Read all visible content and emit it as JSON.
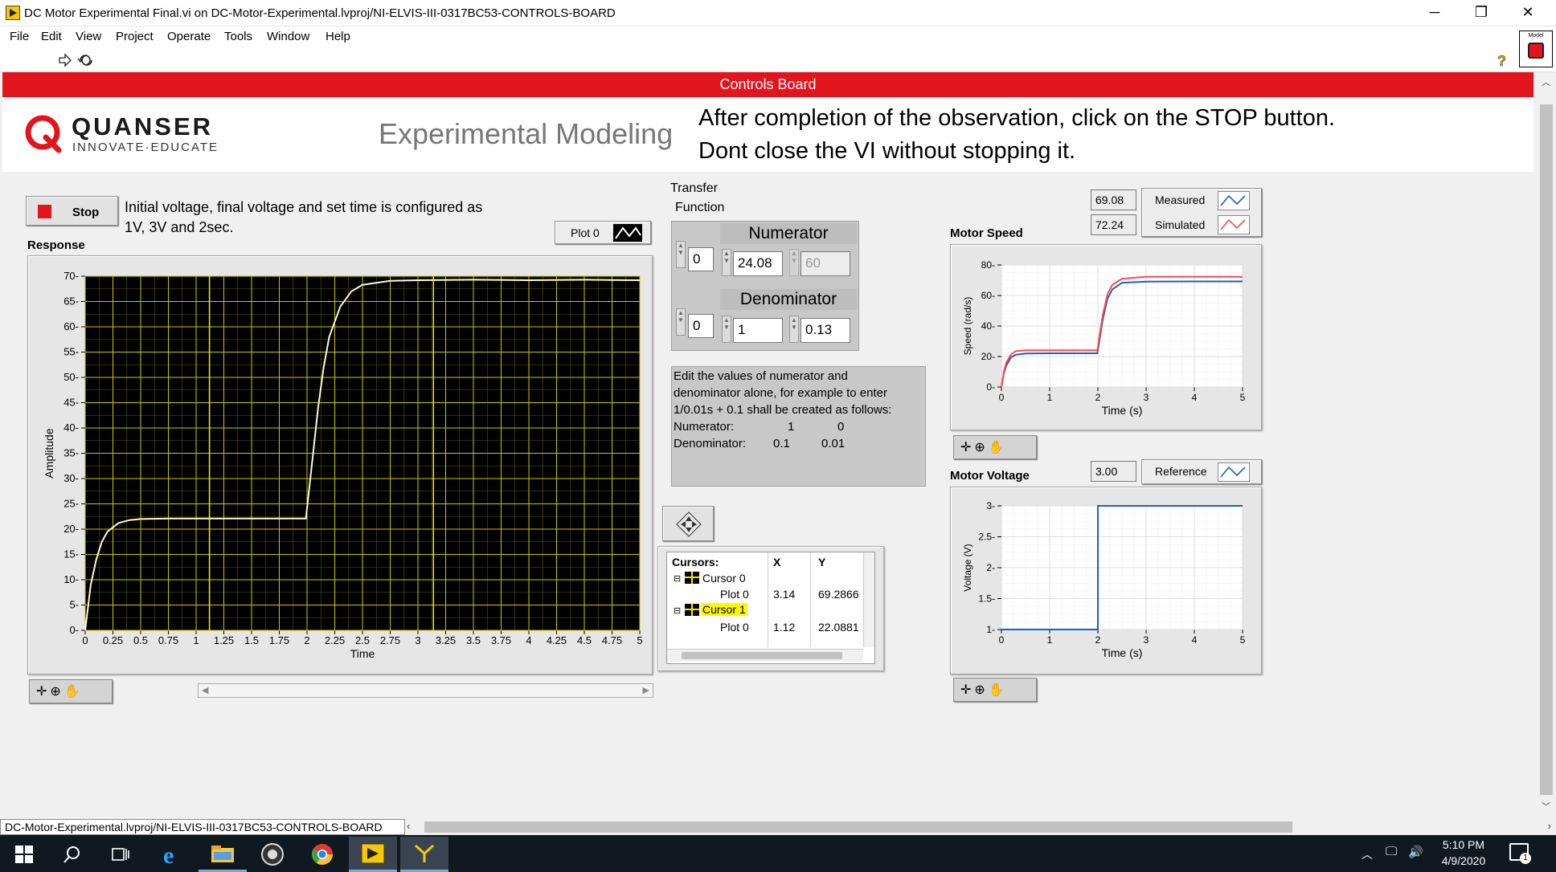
{
  "window": {
    "title": "DC Motor Experimental Final.vi on DC-Motor-Experimental.lvproj/NI-ELVIS-III-0317BC53-CONTROLS-BOARD",
    "minimize": "─",
    "maximize": "❐",
    "close": "✕"
  },
  "menu": [
    "File",
    "Edit",
    "View",
    "Project",
    "Operate",
    "Tools",
    "Window",
    "Help"
  ],
  "vi_icon_label": "Model",
  "banner": "Controls Board",
  "header": {
    "logo_name": "QUANSER",
    "logo_tagline": "INNOVATE·EDUCATE",
    "subtitle": "Experimental Modeling",
    "instruction_line1": "After completion of the observation, click on the STOP button.",
    "instruction_line2": "Dont close the VI without stopping it."
  },
  "controls": {
    "stop_label": "Stop",
    "info_text_line1": "Initial voltage, final voltage and set time is configured as",
    "info_text_line2": "1V, 3V and 2sec.",
    "plot_legend": "Plot 0"
  },
  "transfer_function": {
    "title_line1": "Transfer",
    "title_line2": "Function",
    "numerator_label": "Numerator",
    "numerator_index": "0",
    "numerator_values": [
      "24.08",
      "60"
    ],
    "denominator_label": "Denominator",
    "denominator_index": "0",
    "denominator_values": [
      "1",
      "0.13"
    ],
    "help_lines": [
      "Edit the values of numerator and",
      "denominator alone, for example to enter",
      "1/0.01s + 0.1 shall be created as follows:"
    ],
    "help_num_label": "Numerator:",
    "help_num_values": [
      "1",
      "0"
    ],
    "help_den_label": "Denominator:",
    "help_den_values": [
      "0.1",
      "0.01"
    ]
  },
  "cursors": {
    "header": [
      "Cursors:",
      "X",
      "Y"
    ],
    "rows": [
      {
        "name": "Cursor 0",
        "plot": "Plot 0",
        "x": "3.14",
        "y": "69.2866"
      },
      {
        "name": "Cursor 1",
        "plot": "Plot 0",
        "x": "1.12",
        "y": "22.0881"
      }
    ]
  },
  "speed_panel": {
    "measured_value": "69.08",
    "simulated_value": "72.24",
    "measured_label": "Measured",
    "simulated_label": "Simulated",
    "title": "Motor Speed"
  },
  "voltage_panel": {
    "reference_value": "3.00",
    "reference_label": "Reference",
    "title": "Motor Voltage"
  },
  "statusbar": {
    "path": "DC-Motor-Experimental.lvproj/NI-ELVIS-III-0317BC53-CONTROLS-BOARD"
  },
  "taskbar": {
    "time": "5:10 PM",
    "date": "4/9/2020",
    "notification_count": "1"
  },
  "colors": {
    "banner": "#e2141d",
    "plot_bg": "#000000",
    "plot_grid": "#c8c800",
    "response_trace": "#fffbd0",
    "measured": "#1f5fbf",
    "simulated": "#ff4a4a",
    "reference": "#1f5fbf"
  },
  "chart_data": [
    {
      "type": "line",
      "title": "Response",
      "xlabel": "Time",
      "ylabel": "Amplitude",
      "xlim": [
        0,
        5
      ],
      "ylim": [
        0,
        70
      ],
      "x_ticks": [
        "0",
        "0.25",
        "0.5",
        "0.75",
        "1",
        "1.25",
        "1.5",
        "1.75",
        "2",
        "2.25",
        "2.5",
        "2.75",
        "3",
        "3.25",
        "3.5",
        "3.75",
        "4",
        "4.25",
        "4.5",
        "4.75",
        "5"
      ],
      "y_ticks": [
        "0",
        "5",
        "10",
        "15",
        "20",
        "25",
        "30",
        "35",
        "40",
        "45",
        "50",
        "55",
        "60",
        "65",
        "70"
      ],
      "series": [
        {
          "name": "Plot 0",
          "x": [
            0,
            0.05,
            0.1,
            0.15,
            0.2,
            0.3,
            0.4,
            0.5,
            0.75,
            1.0,
            1.5,
            1.99,
            2.05,
            2.1,
            2.15,
            2.2,
            2.3,
            2.4,
            2.5,
            2.75,
            3.0,
            3.5,
            4.0,
            4.5,
            5.0
          ],
          "y": [
            0,
            9,
            14,
            17.5,
            19.5,
            21.2,
            21.8,
            22,
            22.1,
            22.1,
            22.1,
            22.1,
            34,
            44,
            52,
            58,
            64,
            67,
            68.3,
            69.1,
            69.2,
            69.3,
            69.2,
            69.3,
            69.2
          ]
        }
      ],
      "cursors": [
        {
          "x": 3.14,
          "y": 69.2866
        },
        {
          "x": 1.12,
          "y": 22.0881
        }
      ],
      "grid": true
    },
    {
      "type": "line",
      "title": "Motor Speed",
      "xlabel": "Time (s)",
      "ylabel": "Speed (rad/s)",
      "xlim": [
        0,
        5
      ],
      "ylim": [
        0,
        80
      ],
      "x_ticks": [
        "0",
        "1",
        "2",
        "3",
        "4",
        "5"
      ],
      "y_ticks": [
        "0",
        "20",
        "40",
        "60",
        "80"
      ],
      "series": [
        {
          "name": "Measured",
          "x": [
            0,
            0.05,
            0.1,
            0.2,
            0.3,
            0.5,
            1.0,
            1.99,
            2.05,
            2.1,
            2.2,
            2.3,
            2.5,
            3.0,
            4.0,
            5.0
          ],
          "y": [
            0,
            9,
            14,
            19.5,
            21.2,
            22,
            22.1,
            22.1,
            34,
            44,
            58,
            64,
            68.3,
            69.1,
            69.2,
            69.2
          ]
        },
        {
          "name": "Simulated",
          "x": [
            0,
            0.05,
            0.1,
            0.2,
            0.3,
            0.5,
            1.0,
            1.99,
            2.05,
            2.1,
            2.2,
            2.3,
            2.5,
            3.0,
            4.0,
            5.0
          ],
          "y": [
            0,
            10,
            16,
            21.5,
            23.5,
            24.1,
            24.1,
            24.1,
            37,
            47,
            61,
            67,
            71,
            72.2,
            72.24,
            72.24
          ]
        }
      ],
      "grid": true
    },
    {
      "type": "line",
      "title": "Motor Voltage",
      "xlabel": "Time (s)",
      "ylabel": "Voltage (V)",
      "xlim": [
        0,
        5
      ],
      "ylim": [
        1,
        3
      ],
      "x_ticks": [
        "0",
        "1",
        "2",
        "3",
        "4",
        "5"
      ],
      "y_ticks": [
        "1",
        "1.5",
        "2",
        "2.5",
        "3"
      ],
      "series": [
        {
          "name": "Reference",
          "x": [
            0,
            2,
            2,
            5
          ],
          "y": [
            1,
            1,
            3,
            3
          ]
        }
      ],
      "grid": true
    }
  ]
}
